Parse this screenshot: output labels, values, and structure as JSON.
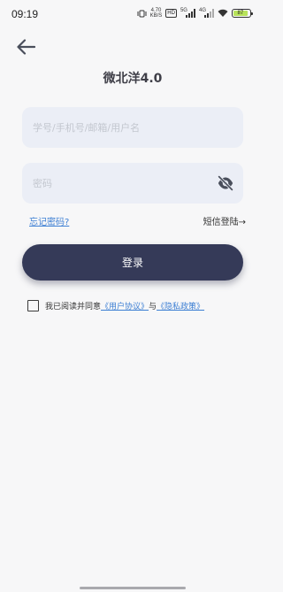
{
  "status_bar": {
    "time": "09:19",
    "net_speed_value": "4.70",
    "net_speed_unit": "KB/S",
    "hd_label": "HD",
    "sig1_label": "5G",
    "sig2_label": "4G",
    "battery_percent": "87",
    "battery_level": 0.87
  },
  "header": {
    "back_icon": "arrow-left-icon",
    "app_title": "微北洋4.0"
  },
  "form": {
    "username_placeholder": "学号/手机号/邮箱/用户名",
    "username_value": "",
    "password_placeholder": "密码",
    "password_value": "",
    "eye_icon": "eye-off-icon",
    "forgot_password": "忘记密码?",
    "sms_login": "短信登陆→",
    "login_button": "登录"
  },
  "agreement": {
    "prefix": "我已阅读并同意",
    "user_agreement": "《用户协议》",
    "conjunction": "与",
    "privacy_policy": "《隐私政策》"
  },
  "colors": {
    "primary": "#353a58",
    "link": "#3d7fd3",
    "input_bg": "#ebeef6",
    "background": "#f7f7f8"
  }
}
